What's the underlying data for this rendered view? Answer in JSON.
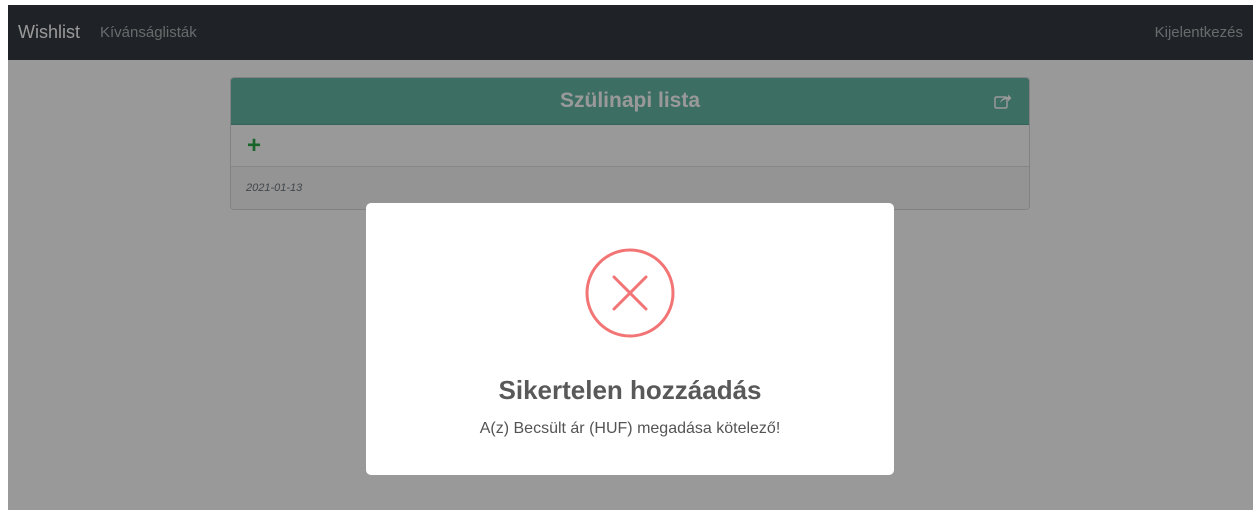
{
  "navbar": {
    "brand": "Wishlist",
    "link_lists": "Kívánságlisták",
    "logout": "Kijelentkezés"
  },
  "card": {
    "title": "Szülinapi lista",
    "add_icon": "plus-icon",
    "share_icon": "share-icon",
    "date": "2021-01-13"
  },
  "modal": {
    "icon": "error-x-icon",
    "title": "Sikertelen hozzáadás",
    "message": "A(z) Becsült ár (HUF) megadása kötelező!"
  },
  "colors": {
    "navbar_bg": "#343a40",
    "card_header_bg": "#66b8a6",
    "add_icon": "#28a745",
    "error_accent": "#f27474"
  }
}
